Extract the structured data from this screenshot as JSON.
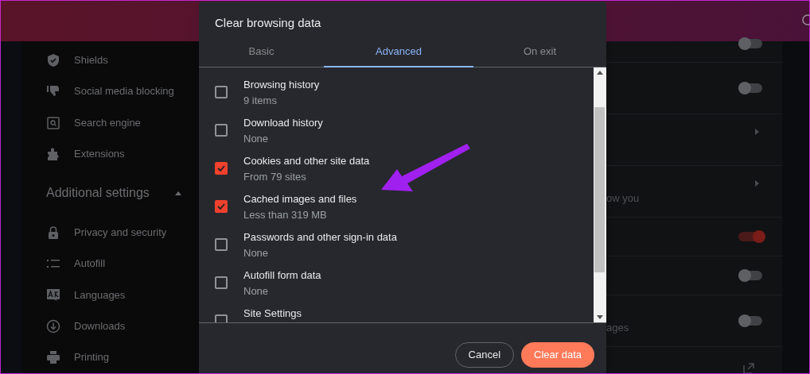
{
  "sidebar": {
    "items": [
      {
        "label": "Shields"
      },
      {
        "label": "Social media blocking"
      },
      {
        "label": "Search engine"
      },
      {
        "label": "Extensions"
      }
    ],
    "section": {
      "title": "Additional settings",
      "expanded": true
    },
    "section_items": [
      {
        "label": "Privacy and security"
      },
      {
        "label": "Autofill"
      },
      {
        "label": "Languages"
      },
      {
        "label": "Downloads"
      },
      {
        "label": "Printing"
      }
    ]
  },
  "settings_rows": [
    {
      "kind": "toggle",
      "on": false
    },
    {
      "kind": "toggle",
      "on": false
    },
    {
      "kind": "arrow"
    },
    {
      "kind": "arrow",
      "text": "ow you"
    },
    {
      "kind": "toggle",
      "on": true
    },
    {
      "kind": "toggle",
      "on": false
    },
    {
      "kind": "toggle",
      "on": false,
      "text": "ages"
    },
    {
      "kind": "external"
    }
  ],
  "dialog": {
    "title": "Clear browsing data",
    "tabs": [
      {
        "label": "Basic",
        "selected": false
      },
      {
        "label": "Advanced",
        "selected": true
      },
      {
        "label": "On exit",
        "selected": false
      }
    ],
    "items": [
      {
        "label": "Browsing history",
        "detail": "9 items",
        "checked": false
      },
      {
        "label": "Download history",
        "detail": "None",
        "checked": false
      },
      {
        "label": "Cookies and other site data",
        "detail": "From 79 sites",
        "checked": true
      },
      {
        "label": "Cached images and files",
        "detail": "Less than 319 MB",
        "checked": true
      },
      {
        "label": "Passwords and other sign-in data",
        "detail": "None",
        "checked": false
      },
      {
        "label": "Autofill form data",
        "detail": "None",
        "checked": false
      },
      {
        "label": "Site Settings",
        "checked": false
      }
    ],
    "buttons": [
      {
        "label": "Cancel",
        "kind": "secondary"
      },
      {
        "label": "Clear data",
        "kind": "primary"
      }
    ]
  }
}
